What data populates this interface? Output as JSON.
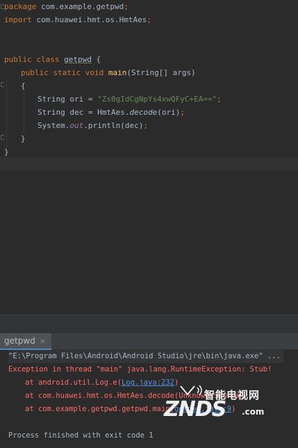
{
  "editor": {
    "package_kw": "package",
    "package_name": "com.example.getpwd",
    "import_kw": "import",
    "import_name": "com.huawei.hmt.os.HmtAes",
    "class_mods": "public class",
    "class_name": "getpwd",
    "method_mods": "public static void",
    "method_name": "main",
    "method_params": "(String[] args)",
    "ori_decl": "String ori = ",
    "ori_value": "\"Zs0gIdCgNpYs4xwQFyC+EA==\"",
    "dec_decl": "String dec = HmtAes.",
    "dec_call": "decode",
    "dec_args": "(ori)",
    "print_obj": "System.",
    "print_field": "out",
    "print_call": ".println(dec)",
    "semicolon": ";",
    "brace_open": "{",
    "brace_close": "}",
    "brace_open_space": " {"
  },
  "run_panel": {
    "tab_label": "getpwd",
    "close_glyph": "×",
    "command": "\"E:\\Program Files\\Android\\Android Studio\\jre\\bin\\java.exe\" ...",
    "exception": "Exception in thread \"main\" java.lang.RuntimeException: Stub!",
    "trace1_prefix": "at android.util.Log.e(",
    "trace1_link": "Log.java:232",
    "trace1_suffix": ")",
    "trace2_prefix": "at com.huawei.hmt.os.HmtAes.decode(",
    "trace2_text": "Unknown Source",
    "trace2_suffix": ")",
    "trace3_prefix": "at com.example.getpwd.getpwd.main(",
    "trace3_link": "getpwd.java:9",
    "trace3_suffix": ")",
    "exit": "Process finished with exit code 1"
  },
  "watermark": {
    "cn": "智能电视网",
    "logo": "ZNDS",
    "com": ".com"
  },
  "colors": {
    "editor_bg": "#2b2b2b",
    "keyword": "#cc7832",
    "method": "#ffc66d",
    "string": "#6a8759",
    "field": "#9876aa",
    "text": "#a9b7c6",
    "error": "#ff6b68",
    "link": "#5394ec"
  }
}
